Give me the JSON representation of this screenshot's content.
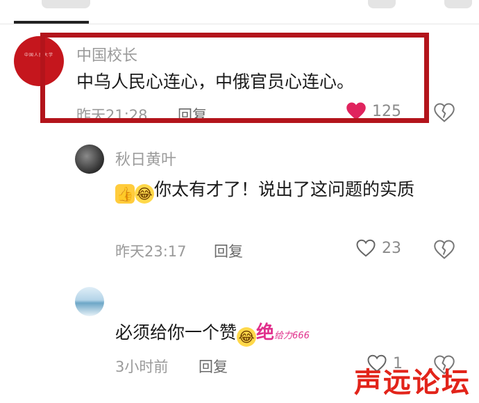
{
  "comments": [
    {
      "username": "中国校长",
      "avatar_text": "中国人民大学",
      "text": "中乌人民心连心，中俄官员心连心。",
      "time": "昨天21:28",
      "reply_label": "回复",
      "likes": "125",
      "liked": true
    },
    {
      "username": "秋日黄叶",
      "text": "你太有才了！说出了这问题的实质",
      "time": "昨天23:17",
      "reply_label": "回复",
      "likes": "23",
      "liked": false
    },
    {
      "username": "",
      "text": "必须给你一个赞",
      "sticker_main": "绝",
      "sticker_small": "给力666",
      "time": "3小时前",
      "reply_label": "回复",
      "likes": "1",
      "liked": false
    }
  ],
  "watermark": "声远论坛",
  "colors": {
    "highlight": "#b3141b",
    "like_active": "#e0245e",
    "meta_text": "#9a9a9a",
    "watermark": "#e2241a"
  },
  "icons": [
    "heart-icon",
    "heart-outline-icon",
    "broken-heart-icon",
    "thumbs-up-emoji",
    "laughing-emoji"
  ]
}
